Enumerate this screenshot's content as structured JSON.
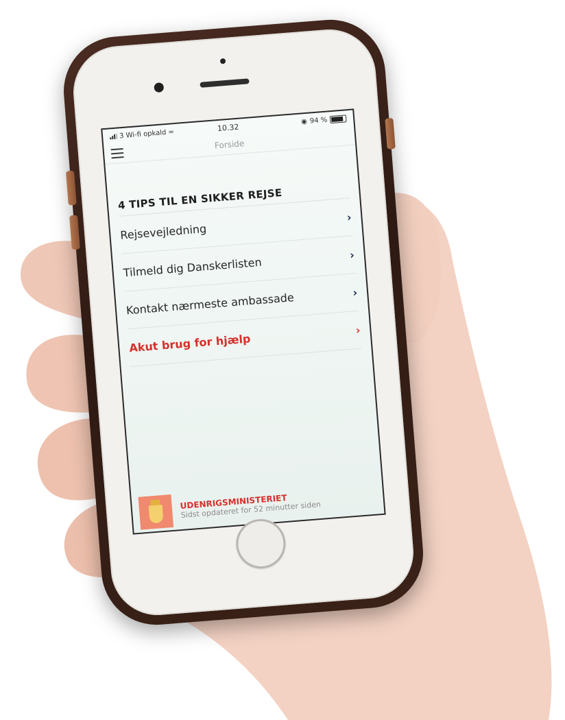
{
  "status_bar": {
    "carrier": "3 Wi-fi opkald",
    "time": "10.32",
    "battery": "94 %",
    "battery_level": 0.94
  },
  "nav": {
    "title": "Forside",
    "menu_icon": "hamburger-icon"
  },
  "section_title": "4 TIPS TIL EN SIKKER REJSE",
  "menu_items": [
    {
      "label": "Rejsevejledning",
      "icon": "chevron-right-icon"
    },
    {
      "label": "Tilmeld dig Danskerlisten",
      "icon": "chevron-right-icon"
    },
    {
      "label": "Kontakt nærmeste ambassade",
      "icon": "chevron-right-icon"
    },
    {
      "label": "Akut brug for hjælp",
      "icon": "chevron-right-icon",
      "color": "#d4312c"
    }
  ],
  "footer": {
    "ministry_name": "UDENRIGSMINISTERIET",
    "last_updated": "Sidst opdateret for 52 minutter siden",
    "logo_color": "#f0896e"
  },
  "colors": {
    "accent_red": "#d4312c",
    "chevron_navy": "#1c2a4a"
  }
}
